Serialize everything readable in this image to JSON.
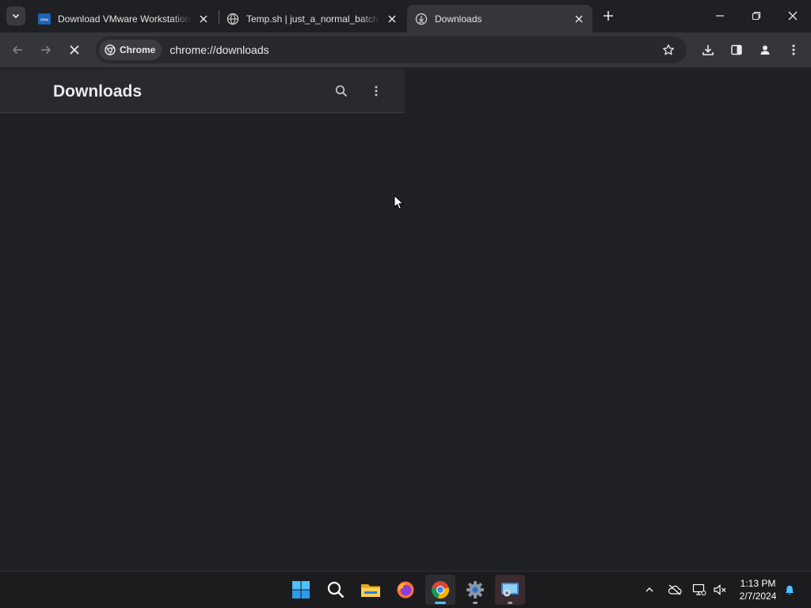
{
  "browser": {
    "tabs": [
      {
        "title": "Download VMware Workstation",
        "favicon": "vmware-favicon",
        "active": false
      },
      {
        "title": "Temp.sh | just_a_normal_batch_",
        "favicon": "globe-favicon",
        "active": false
      },
      {
        "title": "Downloads",
        "favicon": "download-circle-favicon",
        "active": true
      }
    ],
    "address": {
      "chip_label": "Chrome",
      "url": "chrome://downloads"
    }
  },
  "page": {
    "title": "Downloads"
  },
  "taskbar": {
    "apps": [
      "start",
      "search",
      "file-explorer",
      "firefox",
      "chrome",
      "settings",
      "remote-app"
    ],
    "clock": {
      "time": "1:13 PM",
      "date": "2/7/2024"
    }
  },
  "colors": {
    "page_bg": "#202124",
    "header_bg": "#292a2d",
    "toolbar_bg": "#35363a",
    "taskbar_bg": "#1c1c1e",
    "accent_blue": "#4cc2ff"
  }
}
